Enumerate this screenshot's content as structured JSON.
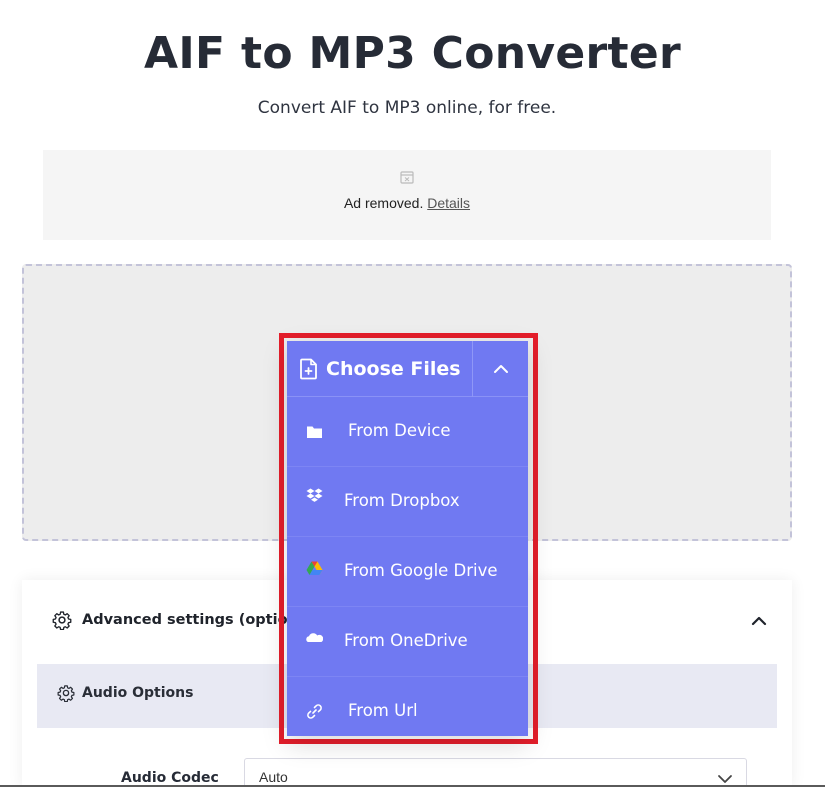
{
  "header": {
    "title": "AIF to MP3 Converter",
    "subtitle": "Convert AIF to MP3 online, for free."
  },
  "ad": {
    "text": "Ad removed.",
    "link": "Details",
    "icon": "calendar-x-icon"
  },
  "upload": {
    "choose_label": "Choose Files",
    "toggle_icon": "chevron-up-icon",
    "menu": [
      {
        "label": "From Device",
        "icon": "folder-icon"
      },
      {
        "label": "From Dropbox",
        "icon": "dropbox-icon"
      },
      {
        "label": "From Google Drive",
        "icon": "google-drive-icon"
      },
      {
        "label": "From OneDrive",
        "icon": "onedrive-icon"
      },
      {
        "label": "From Url",
        "icon": "link-icon"
      }
    ]
  },
  "settings": {
    "title": "Advanced settings (option",
    "section_label": "Audio Options",
    "codec_label": "Audio Codec",
    "codec_value": "Auto"
  },
  "colors": {
    "accent": "#7079f2",
    "highlight": "#e41e2b",
    "text": "#262b36"
  }
}
